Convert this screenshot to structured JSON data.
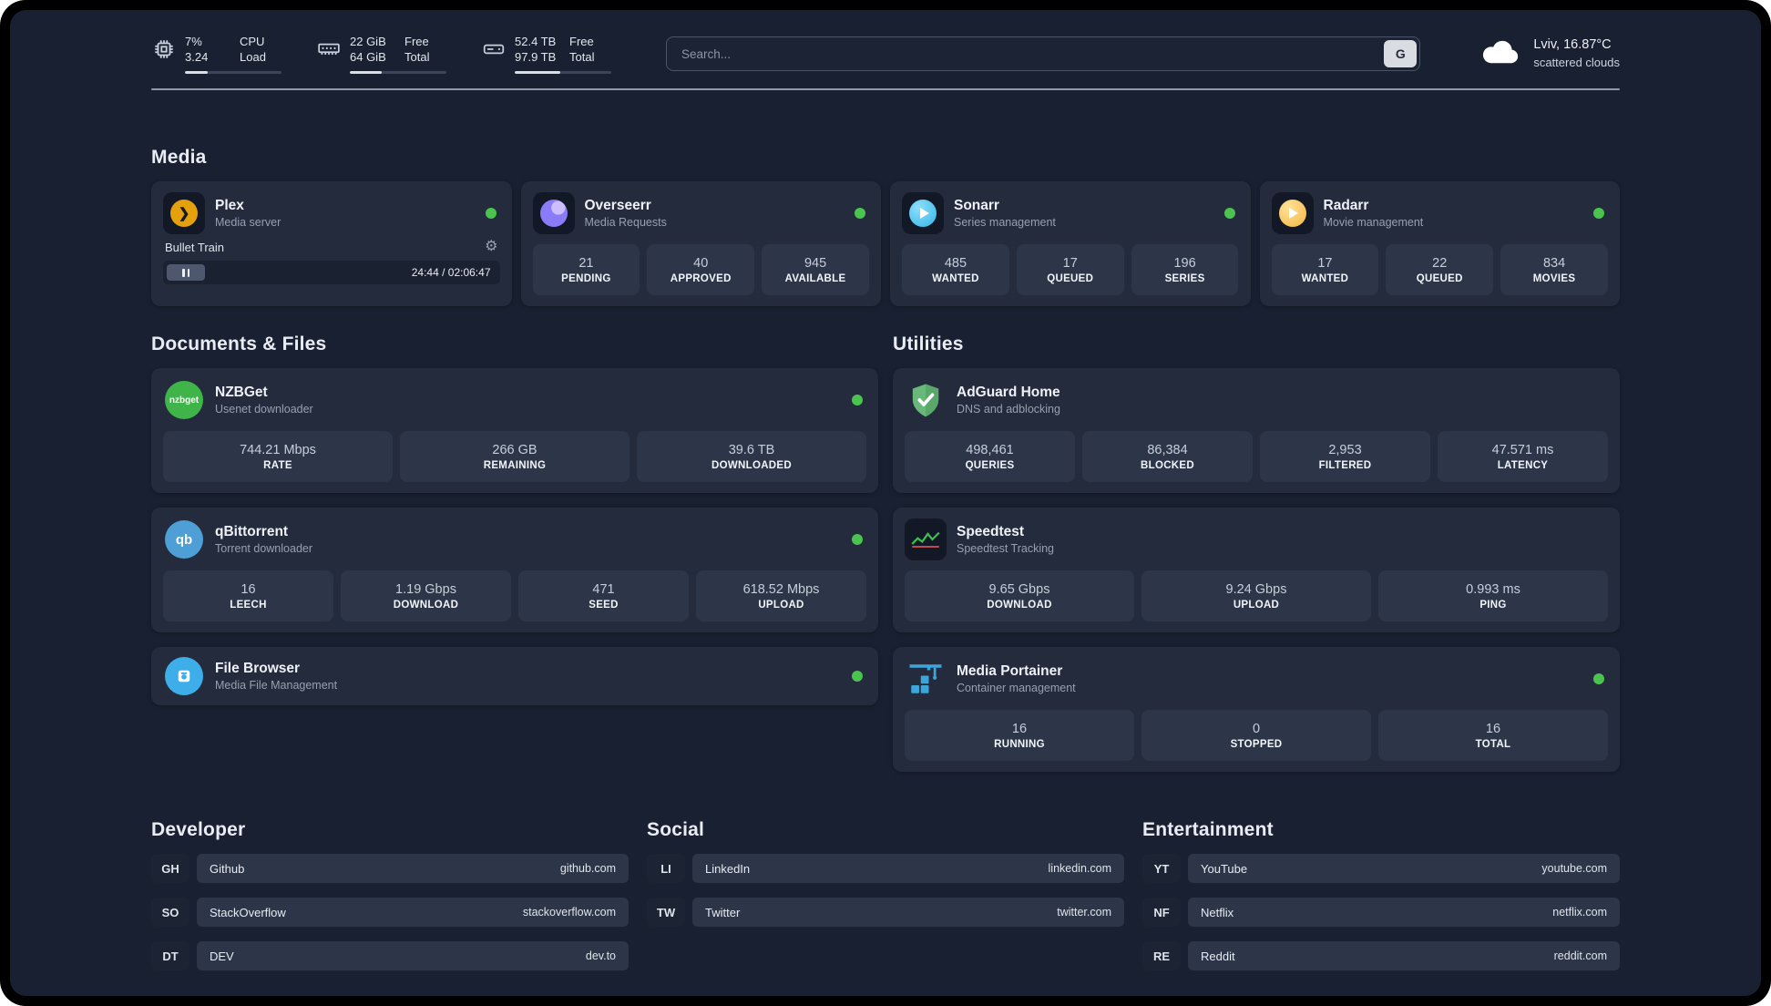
{
  "header": {
    "system_stats": [
      {
        "values": [
          "7%",
          "3.24"
        ],
        "labels": [
          "CPU",
          "Load"
        ],
        "progress": 24
      },
      {
        "values": [
          "22 GiB",
          "64 GiB"
        ],
        "labels": [
          "Free",
          "Total"
        ],
        "progress": 33
      },
      {
        "values": [
          "52.4 TB",
          "97.9 TB"
        ],
        "labels": [
          "Free",
          "Total"
        ],
        "progress": 47
      }
    ],
    "search": {
      "placeholder": "Search...",
      "button_label": "G"
    },
    "weather": {
      "location": "Lviv, 16.87°C",
      "condition": "scattered clouds"
    }
  },
  "media": {
    "title": "Media",
    "plex": {
      "name": "Plex",
      "subtitle": "Media server",
      "player": {
        "track": "Bullet Train",
        "time": "24:44 / 02:06:47"
      }
    },
    "overseerr": {
      "name": "Overseerr",
      "subtitle": "Media Requests",
      "stats": [
        {
          "value": "21",
          "label": "PENDING"
        },
        {
          "value": "40",
          "label": "APPROVED"
        },
        {
          "value": "945",
          "label": "AVAILABLE"
        }
      ]
    },
    "sonarr": {
      "name": "Sonarr",
      "subtitle": "Series management",
      "stats": [
        {
          "value": "485",
          "label": "WANTED"
        },
        {
          "value": "17",
          "label": "QUEUED"
        },
        {
          "value": "196",
          "label": "SERIES"
        }
      ]
    },
    "radarr": {
      "name": "Radarr",
      "subtitle": "Movie management",
      "stats": [
        {
          "value": "17",
          "label": "WANTED"
        },
        {
          "value": "22",
          "label": "QUEUED"
        },
        {
          "value": "834",
          "label": "MOVIES"
        }
      ]
    }
  },
  "documents": {
    "title": "Documents & Files",
    "nzbget": {
      "name": "NZBGet",
      "subtitle": "Usenet downloader",
      "icon_label": "nzbget",
      "stats": [
        {
          "value": "744.21 Mbps",
          "label": "RATE"
        },
        {
          "value": "266 GB",
          "label": "REMAINING"
        },
        {
          "value": "39.6 TB",
          "label": "DOWNLOADED"
        }
      ]
    },
    "qbittorrent": {
      "name": "qBittorrent",
      "subtitle": "Torrent downloader",
      "icon_label": "qb",
      "stats": [
        {
          "value": "16",
          "label": "LEECH"
        },
        {
          "value": "1.19 Gbps",
          "label": "DOWNLOAD"
        },
        {
          "value": "471",
          "label": "SEED"
        },
        {
          "value": "618.52 Mbps",
          "label": "UPLOAD"
        }
      ]
    },
    "filebrowser": {
      "name": "File Browser",
      "subtitle": "Media File Management"
    }
  },
  "utilities": {
    "title": "Utilities",
    "adguard": {
      "name": "AdGuard Home",
      "subtitle": "DNS and adblocking",
      "stats": [
        {
          "value": "498,461",
          "label": "QUERIES"
        },
        {
          "value": "86,384",
          "label": "BLOCKED"
        },
        {
          "value": "2,953",
          "label": "FILTERED"
        },
        {
          "value": "47.571 ms",
          "label": "LATENCY"
        }
      ]
    },
    "speedtest": {
      "name": "Speedtest",
      "subtitle": "Speedtest Tracking",
      "stats": [
        {
          "value": "9.65 Gbps",
          "label": "DOWNLOAD"
        },
        {
          "value": "9.24 Gbps",
          "label": "UPLOAD"
        },
        {
          "value": "0.993 ms",
          "label": "PING"
        }
      ]
    },
    "portainer": {
      "name": "Media Portainer",
      "subtitle": "Container management",
      "stats": [
        {
          "value": "16",
          "label": "RUNNING"
        },
        {
          "value": "0",
          "label": "STOPPED"
        },
        {
          "value": "16",
          "label": "TOTAL"
        }
      ]
    }
  },
  "bookmarks": {
    "developer": {
      "title": "Developer",
      "items": [
        {
          "abbr": "GH",
          "name": "Github",
          "url": "github.com"
        },
        {
          "abbr": "SO",
          "name": "StackOverflow",
          "url": "stackoverflow.com"
        },
        {
          "abbr": "DT",
          "name": "DEV",
          "url": "dev.to"
        }
      ]
    },
    "social": {
      "title": "Social",
      "items": [
        {
          "abbr": "LI",
          "name": "LinkedIn",
          "url": "linkedin.com"
        },
        {
          "abbr": "TW",
          "name": "Twitter",
          "url": "twitter.com"
        }
      ]
    },
    "entertainment": {
      "title": "Entertainment",
      "items": [
        {
          "abbr": "YT",
          "name": "YouTube",
          "url": "youtube.com"
        },
        {
          "abbr": "NF",
          "name": "Netflix",
          "url": "netflix.com"
        },
        {
          "abbr": "RE",
          "name": "Reddit",
          "url": "reddit.com"
        }
      ]
    }
  },
  "colors": {
    "status_online": "#4ac34f",
    "plex": "#e5a00d",
    "overseerr": "#8a7cf8",
    "sonarr": "#33b5e5",
    "radarr": "#f4b63f",
    "nzbget": "#3fb549",
    "qbittorrent": "#4f9fd7",
    "filebrowser": "#3daee9",
    "adguard": "#68b87a",
    "speedtest": "#3fbf4f",
    "portainer": "#3ca6db"
  }
}
